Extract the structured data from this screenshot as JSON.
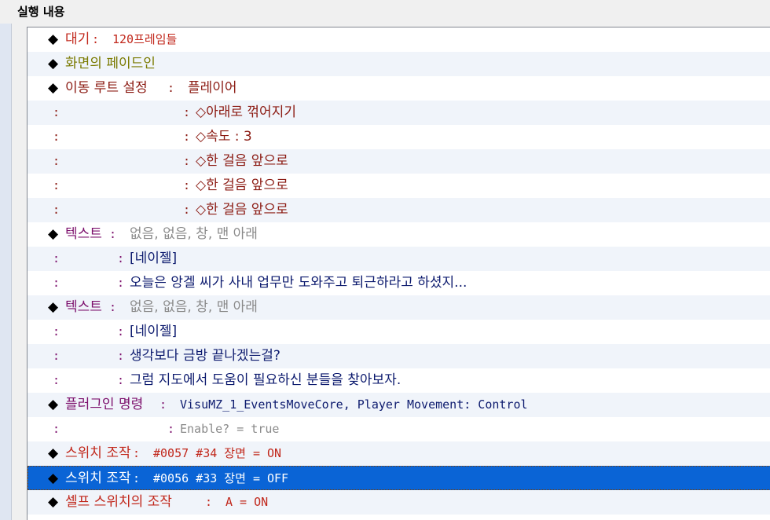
{
  "header": {
    "title": "실행 내용"
  },
  "rows": [
    {
      "marker": "◆",
      "label": "대기",
      "sep": " : ",
      "value": "120프레임들"
    },
    {
      "marker": "◆",
      "label": "화면의 페이드인"
    },
    {
      "marker": "◆",
      "label": "이동 루트 설정",
      "sep": " : ",
      "value": "플레이어"
    },
    {
      "colon": ":",
      "sep": ": ",
      "value": "◇아래로 꺾어지기"
    },
    {
      "colon": ":",
      "sep": ": ",
      "value": "◇속도 : 3"
    },
    {
      "colon": ":",
      "sep": ": ",
      "value": "◇한 걸음 앞으로"
    },
    {
      "colon": ":",
      "sep": ": ",
      "value": "◇한 걸음 앞으로"
    },
    {
      "colon": ":",
      "sep": ": ",
      "value": "◇한 걸음 앞으로"
    },
    {
      "marker": "◆",
      "label": "텍스트",
      "sep": " : ",
      "value": "없음, 없음, 창, 맨 아래"
    },
    {
      "colon": ":",
      "sep": ": ",
      "value": "[네이젤]"
    },
    {
      "colon": ":",
      "sep": ": ",
      "value": "오늘은 앙겔 씨가 사내 업무만 도와주고 퇴근하라고 하셨지..."
    },
    {
      "marker": "◆",
      "label": "텍스트",
      "sep": " : ",
      "value": "없음, 없음, 창, 맨 아래"
    },
    {
      "colon": ":",
      "sep": ": ",
      "value": "[네이젤]"
    },
    {
      "colon": ":",
      "sep": ": ",
      "value": "생각보다 금방 끝나겠는걸?"
    },
    {
      "colon": ":",
      "sep": ": ",
      "value": "그럼 지도에서 도움이 필요하신 분들을 찾아보자."
    },
    {
      "marker": "◆",
      "label": "플러그인 명령",
      "sep": " : ",
      "value": "VisuMZ_1_EventsMoveCore, Player Movement: Control"
    },
    {
      "colon": ":",
      "sep": ": ",
      "value": "Enable? = true"
    },
    {
      "marker": "◆",
      "label": "스위치 조작",
      "sep": " : ",
      "value": "#0057 #34 장면 = ON"
    },
    {
      "marker": "◆",
      "label": "스위치 조작",
      "sep": " : ",
      "value": "#0056 #33 장면 = OFF",
      "selected": true
    },
    {
      "marker": "◆",
      "label": "셀프 스위치의 조작",
      "sep": " : ",
      "value": "A = ON"
    },
    {
      "marker": "◆"
    }
  ],
  "colors": {
    "command_red": "#c1271b",
    "value_dark_red": "#8b1a12",
    "olive": "#7a7a00",
    "text_purple": "#7c0f6c",
    "navy": "#0c1a6e",
    "gray": "#8a8a8a",
    "selection": "#0a64d6"
  }
}
